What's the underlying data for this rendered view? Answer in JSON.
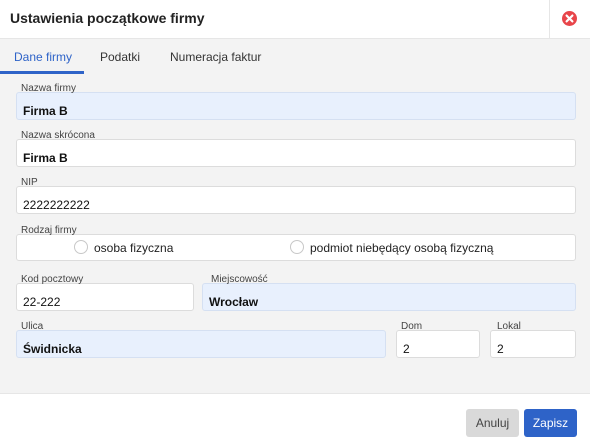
{
  "dialog": {
    "title": "Ustawienia początkowe firmy",
    "close_icon": "close-icon",
    "colors": {
      "accent": "#2e63c8",
      "close": "#e8454a",
      "highlight_field": "#e8f0fd"
    }
  },
  "tabs": [
    {
      "label": "Dane firmy",
      "active": true
    },
    {
      "label": "Podatki",
      "active": false
    },
    {
      "label": "Numeracja faktur",
      "active": false
    }
  ],
  "form": {
    "company_name": {
      "label": "Nazwa firmy",
      "value": "Firma B"
    },
    "short_name": {
      "label": "Nazwa skrócona",
      "value": "Firma B"
    },
    "nip": {
      "label": "NIP",
      "value": "2222222222"
    },
    "company_type": {
      "label": "Rodzaj firmy",
      "options": [
        "osoba fizyczna",
        "podmiot niebędący osobą fizyczną"
      ],
      "selected": null
    },
    "postal_code": {
      "label": "Kod pocztowy",
      "value": "22-222"
    },
    "city": {
      "label": "Miejscowość",
      "value": "Wrocław"
    },
    "street": {
      "label": "Ulica",
      "value": "Świdnicka"
    },
    "house_no": {
      "label": "Dom",
      "value": "2"
    },
    "unit_no": {
      "label": "Lokal",
      "value": "2"
    }
  },
  "footer": {
    "cancel_label": "Anuluj",
    "save_label": "Zapisz"
  }
}
